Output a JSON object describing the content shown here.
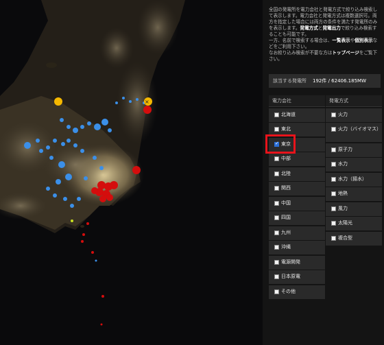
{
  "description": {
    "line1": "全国の発電所を電力会社と発電方式で絞り込み検索して表示します。電力会社と発電方式は複数選択可。両方を指定した場合には両方の条件を満たす発電所のみを表示します。",
    "bold1": "発電方式",
    "mid1": "と",
    "bold2": "発電出力",
    "tail1": "で絞り込み検索することも可能です。",
    "line2a": "一方、名前で検索する場合は、",
    "bold3": "一覧表示",
    "line2b": "や",
    "bold4": "個別表示",
    "line2c": "などをご利用下さい。",
    "line3a": "なお絞り込み検索が不要な方は",
    "bold5": "トップページ",
    "line3b": "をご覧下さい。"
  },
  "result": {
    "label": "該当する発電所",
    "value": "192件 / 62406.185MW"
  },
  "companies": {
    "header": "電力会社",
    "items": [
      {
        "label": "北海道",
        "checked": false
      },
      {
        "label": "東北",
        "checked": false
      },
      {
        "label": "東京",
        "checked": true
      },
      {
        "label": "中部",
        "checked": false
      },
      {
        "label": "北陸",
        "checked": false
      },
      {
        "label": "関西",
        "checked": false
      },
      {
        "label": "中国",
        "checked": false
      },
      {
        "label": "四国",
        "checked": false
      },
      {
        "label": "九州",
        "checked": false
      },
      {
        "label": "沖縄",
        "checked": false
      },
      {
        "label": "電源開発",
        "checked": false
      },
      {
        "label": "日本原電",
        "checked": false
      },
      {
        "label": "その他",
        "checked": false
      }
    ]
  },
  "methods": {
    "header": "発電方式",
    "items": [
      {
        "label": "火力",
        "checked": false
      },
      {
        "label": "火力（バイオマス）",
        "checked": false
      },
      {
        "label": "原子力",
        "checked": false
      },
      {
        "label": "水力",
        "checked": false
      },
      {
        "label": "水力（揚水）",
        "checked": false
      },
      {
        "label": "地熱",
        "checked": false
      },
      {
        "label": "風力",
        "checked": false
      },
      {
        "label": "太陽光",
        "checked": false
      },
      {
        "label": "複合型",
        "checked": false
      }
    ]
  },
  "colors": {
    "highlight": "#e8131b",
    "thermal": "#d40d0d",
    "hydro": "#3b8fe8",
    "nuclear": "#f5b800"
  }
}
